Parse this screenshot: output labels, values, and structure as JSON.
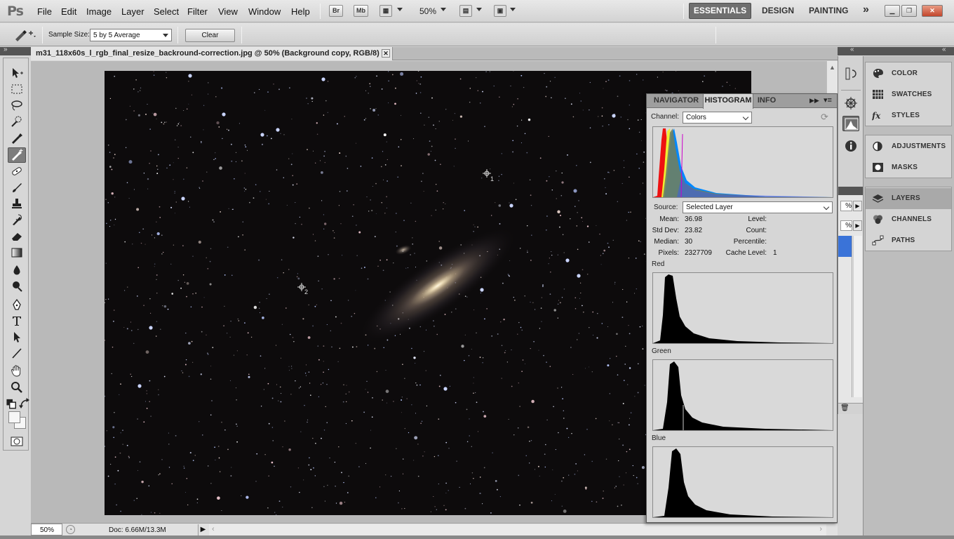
{
  "app": {
    "logo": "Ps",
    "menus": [
      "File",
      "Edit",
      "Image",
      "Layer",
      "Select",
      "Filter",
      "View",
      "Window",
      "Help"
    ],
    "bridge_label": "Br",
    "minibridge_label": "Mb",
    "zoom_menu": "50%",
    "workspaces": {
      "essentials": "ESSENTIALS",
      "design": "DESIGN",
      "painting": "PAINTING",
      "more": "»"
    }
  },
  "options": {
    "sample_size_label": "Sample Size:",
    "sample_size_value": "5 by 5 Average",
    "clear_label": "Clear"
  },
  "document": {
    "tab_title": "m31_118x60s_l_rgb_final_resize_backround-correction.jpg @ 50% (Background copy, RGB/8) *",
    "zoom": "50%",
    "doc_info": "Doc: 6.66M/13.3M",
    "sampler_1": "1",
    "sampler_2": "2"
  },
  "histogram_panel": {
    "tabs": [
      "NAVIGATOR",
      "HISTOGRAM",
      "INFO"
    ],
    "channel_label": "Channel:",
    "channel_value": "Colors",
    "source_label": "Source:",
    "source_value": "Selected Layer",
    "stats": {
      "mean_label": "Mean:",
      "mean": "36.98",
      "std_label": "Std Dev:",
      "std": "23.82",
      "median_label": "Median:",
      "median": "30",
      "pixels_label": "Pixels:",
      "pixels": "2327709",
      "level_label": "Level:",
      "count_label": "Count:",
      "percentile_label": "Percentile:",
      "cache_label": "Cache Level:",
      "cache": "1"
    },
    "channels": [
      "Red",
      "Green",
      "Blue"
    ]
  },
  "right_panels": {
    "group1": [
      "COLOR",
      "SWATCHES",
      "STYLES"
    ],
    "group2": [
      "ADJUSTMENTS",
      "MASKS"
    ],
    "group3": [
      "LAYERS",
      "CHANNELS",
      "PATHS"
    ]
  },
  "colors": {
    "workspace_active": "#6f6f6f",
    "selection_blue": "#3a73d8",
    "image_background": "#0d0b0c"
  }
}
